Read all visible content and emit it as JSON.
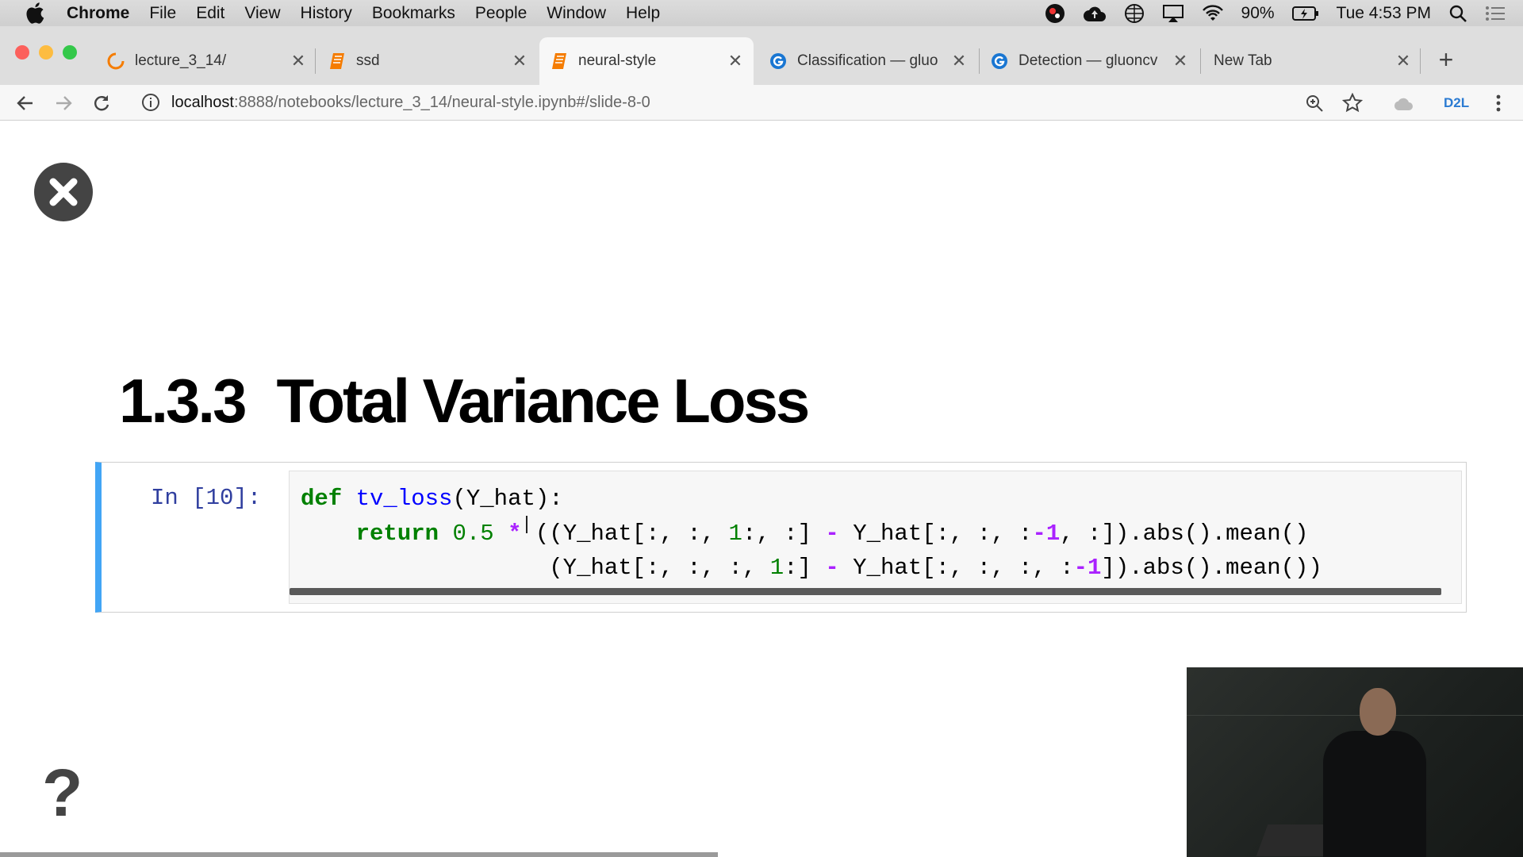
{
  "menubar": {
    "app_name": "Chrome",
    "items": [
      "File",
      "Edit",
      "View",
      "History",
      "Bookmarks",
      "People",
      "Window",
      "Help"
    ],
    "battery": "90%",
    "clock": "Tue 4:53 PM"
  },
  "tabs": [
    {
      "label": "lecture_3_14/",
      "icon": "loading-spinner-icon"
    },
    {
      "label": "ssd",
      "icon": "notebook-icon"
    },
    {
      "label": "neural-style",
      "icon": "notebook-icon",
      "active": true
    },
    {
      "label": "Classification — gluo",
      "icon": "gluon-icon"
    },
    {
      "label": "Detection — gluoncv",
      "icon": "gluon-icon"
    },
    {
      "label": "New Tab",
      "icon": ""
    }
  ],
  "toolbar": {
    "url_host": "localhost",
    "url_path": ":8888/notebooks/lecture_3_14/neural-style.ipynb#/slide-8-0",
    "extension_label": "D2L"
  },
  "slide": {
    "section_number": "1.3.3",
    "title": "Total Variance Loss",
    "cell_prompt": "In [10]:",
    "code": {
      "l1_kw": "def",
      "l1_fn": "tv_loss",
      "l1_rest": "(Y_hat):",
      "l2_indent": "    ",
      "l2_kw": "return",
      "l2_num": "0.5",
      "l2_op": "*",
      "l2_a": "((Y_hat[:, :,",
      "l2_n1": "1",
      "l2_b": ":, :]",
      "l2_minus": "-",
      "l2_c": "Y_hat[:, :, :",
      "l2_neg": "-1",
      "l2_d": ", :]).abs().mean()",
      "l3_indent": "                  ",
      "l3_a": "(Y_hat[:, :, :,",
      "l3_n1": "1",
      "l3_b": ":]",
      "l3_minus": "-",
      "l3_c": "Y_hat[:, :, :, :",
      "l3_neg": "-1",
      "l3_d": "]).abs().mean())"
    }
  }
}
